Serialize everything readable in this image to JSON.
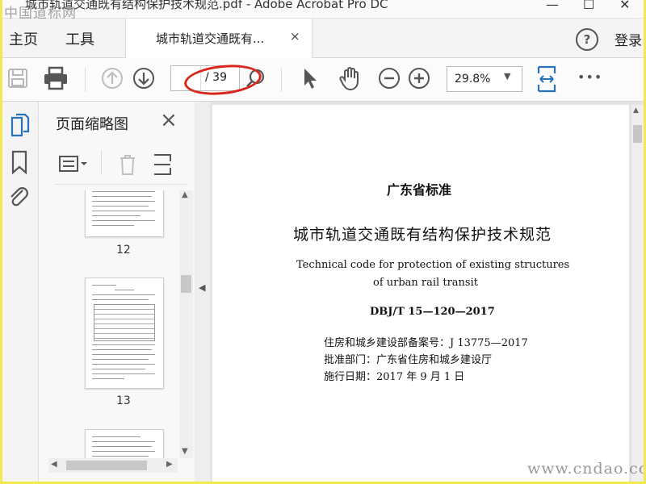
{
  "window": {
    "title": "城市轨道交通既有结构保护技术规范.pdf - Adobe Acrobat Pro DC",
    "watermark_top": "中国道标网"
  },
  "menu": {
    "home": "主页",
    "tools": "工具",
    "login": "登录",
    "help": "?"
  },
  "tab": {
    "label": "城市轨道交通既有...",
    "close": "×"
  },
  "toolbar": {
    "page_total": "/ 39",
    "zoom": "29.8%",
    "more": "•••"
  },
  "panel": {
    "title": "页面缩略图",
    "close": "×",
    "thumbs": [
      {
        "number": "12"
      },
      {
        "number": "13"
      }
    ]
  },
  "document": {
    "org_heading": "广东省标准",
    "title_cn": "城市轨道交通既有结构保护技术规范",
    "title_en_1": "Technical code for protection of existing structures",
    "title_en_2": "of urban rail transit",
    "code": "DBJ/T 15—120—2017",
    "record_no": "住房和城乡建设部备案号：J 13775—2017",
    "approver": "批准部门：广东省住房和城乡建设厅",
    "effective_date": "施行日期：2017 年 9 月 1 日"
  },
  "watermark_bottom": "www.cndao.com",
  "colors": {
    "frame": "#f2e94e",
    "highlight_ellipse": "#d9261c",
    "icon": "#555555"
  }
}
